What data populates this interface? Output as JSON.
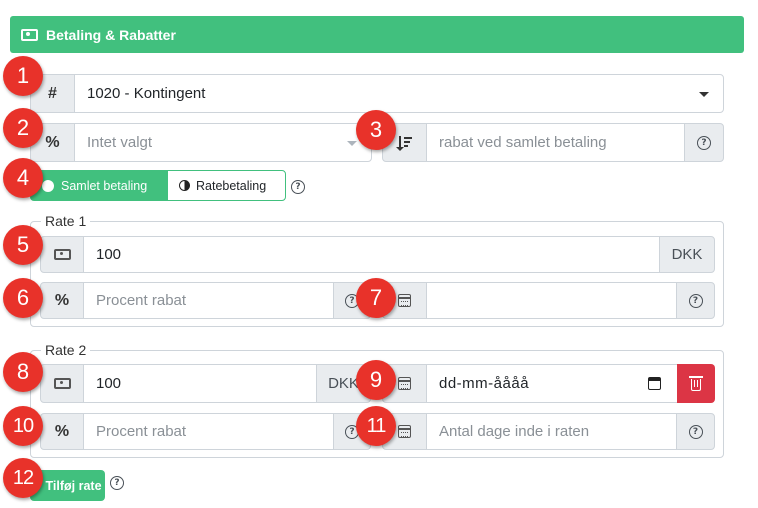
{
  "header": {
    "title": "Betaling & Rabatter",
    "icon": "money-icon"
  },
  "contingent_select": {
    "prefix": "#",
    "value": "1020 - Kontingent"
  },
  "discount_select": {
    "prefix": "%",
    "value": "Intet valgt"
  },
  "discount_text": {
    "placeholder": "rabat ved samlet betaling"
  },
  "payment_toggle": {
    "option_on": "Samlet betaling",
    "option_off": "Ratebetaling"
  },
  "rate1": {
    "legend": "Rate 1",
    "amount": "100",
    "currency": "DKK",
    "percent_prefix": "%",
    "percent_placeholder": "Procent rabat",
    "date_value": ""
  },
  "rate2": {
    "legend": "Rate 2",
    "amount": "100",
    "currency": "DKK",
    "date_value": "dd-mm-åååå",
    "percent_prefix": "%",
    "percent_placeholder": "Procent rabat",
    "days_placeholder": "Antal dage inde i raten"
  },
  "add_rate_button": {
    "label": "Tilføj rate"
  },
  "badges": [
    "1",
    "2",
    "3",
    "4",
    "5",
    "6",
    "7",
    "8",
    "9",
    "10",
    "11",
    "12"
  ],
  "colors": {
    "accent": "#41c07e",
    "danger": "#dc3545",
    "badge": "#e8322a"
  }
}
